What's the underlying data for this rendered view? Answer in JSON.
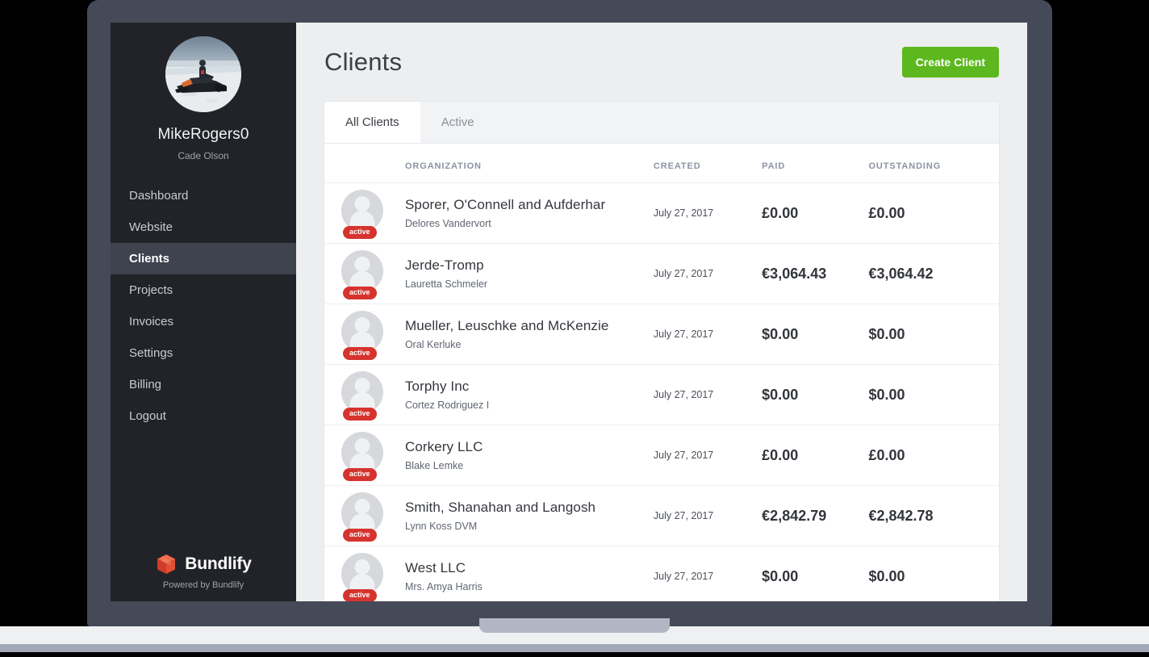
{
  "sidebar": {
    "profile": {
      "username": "MikeRogers0",
      "fullname": "Cade Olson",
      "avatar_icon": "snowmobile-photo-avatar"
    },
    "items": [
      {
        "label": "Dashboard",
        "active": false
      },
      {
        "label": "Website",
        "active": false
      },
      {
        "label": "Clients",
        "active": true
      },
      {
        "label": "Projects",
        "active": false
      },
      {
        "label": "Invoices",
        "active": false
      },
      {
        "label": "Settings",
        "active": false
      },
      {
        "label": "Billing",
        "active": false
      },
      {
        "label": "Logout",
        "active": false
      }
    ],
    "brand": {
      "name": "Bundlify",
      "tagline": "Powered by Bundlify",
      "logo_icon": "cube-box-icon",
      "logo_color": "#e24b34"
    }
  },
  "header": {
    "title": "Clients",
    "create_button": "Create Client",
    "create_button_color": "#5cb81e"
  },
  "tabs": [
    {
      "label": "All Clients",
      "active": true
    },
    {
      "label": "Active",
      "active": false
    }
  ],
  "table": {
    "columns": [
      "",
      "ORGANIZATION",
      "CREATED",
      "PAID",
      "OUTSTANDING"
    ],
    "rows": [
      {
        "organization": "Sporer, O'Connell and Aufderhar",
        "contact": "Delores Vandervort",
        "created": "July 27, 2017",
        "paid": "£0.00",
        "outstanding": "£0.00",
        "status": "active"
      },
      {
        "organization": "Jerde-Tromp",
        "contact": "Lauretta Schmeler",
        "created": "July 27, 2017",
        "paid": "€3,064.43",
        "outstanding": "€3,064.42",
        "status": "active"
      },
      {
        "organization": "Mueller, Leuschke and McKenzie",
        "contact": "Oral Kerluke",
        "created": "July 27, 2017",
        "paid": "$0.00",
        "outstanding": "$0.00",
        "status": "active"
      },
      {
        "organization": "Torphy Inc",
        "contact": "Cortez Rodriguez I",
        "created": "July 27, 2017",
        "paid": "$0.00",
        "outstanding": "$0.00",
        "status": "active"
      },
      {
        "organization": "Corkery LLC",
        "contact": "Blake Lemke",
        "created": "July 27, 2017",
        "paid": "£0.00",
        "outstanding": "£0.00",
        "status": "active"
      },
      {
        "organization": "Smith, Shanahan and Langosh",
        "contact": "Lynn Koss DVM",
        "created": "July 27, 2017",
        "paid": "€2,842.79",
        "outstanding": "€2,842.78",
        "status": "active"
      },
      {
        "organization": "West LLC",
        "contact": "Mrs. Amya Harris",
        "created": "July 27, 2017",
        "paid": "$0.00",
        "outstanding": "$0.00",
        "status": "active"
      }
    ]
  }
}
